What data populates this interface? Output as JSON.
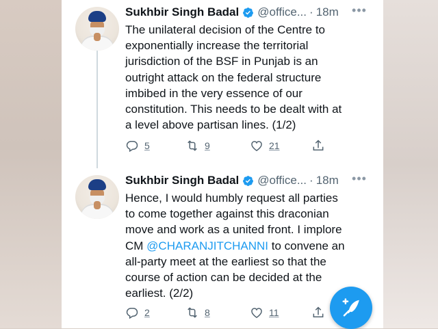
{
  "tweets": [
    {
      "author_name": "Sukhbir Singh Badal",
      "handle": "@office...",
      "separator": "·",
      "time": "18m",
      "text": "The unilateral decision of the Centre to\nexponentially increase the territorial\njurisdiction of the BSF in Punjab is an\noutright attack on the federal structure\nimbibed in the very essence of our\nconstitution. This needs to be dealt with at\na level above partisan lines. (1/2)",
      "replies": "5",
      "retweets": "9",
      "likes": "21"
    },
    {
      "author_name": "Sukhbir Singh Badal",
      "handle": "@office...",
      "separator": "·",
      "time": "18m",
      "text_before_mention": "Hence, I would humbly request all parties\nto come together against this draconian\nmove and work as a united front. I implore\nCM ",
      "mention": "@CHARANJITCHANNI",
      "text_after_mention": " to convene an\nall-party meet at the earliest so that the\ncourse of action can be decided at the\nearliest. (2/2)",
      "replies": "2",
      "retweets": "8",
      "likes": "11"
    }
  ],
  "icons": {
    "verified": "verified-badge-icon",
    "more": "more-options-icon",
    "reply": "reply-icon",
    "retweet": "retweet-icon",
    "like": "heart-icon",
    "share": "share-icon",
    "compose": "compose-tweet-icon"
  },
  "colors": {
    "accent": "#1d9bf0",
    "text": "#0f1419",
    "secondary": "#536471",
    "thread_line": "#cfd9de"
  }
}
